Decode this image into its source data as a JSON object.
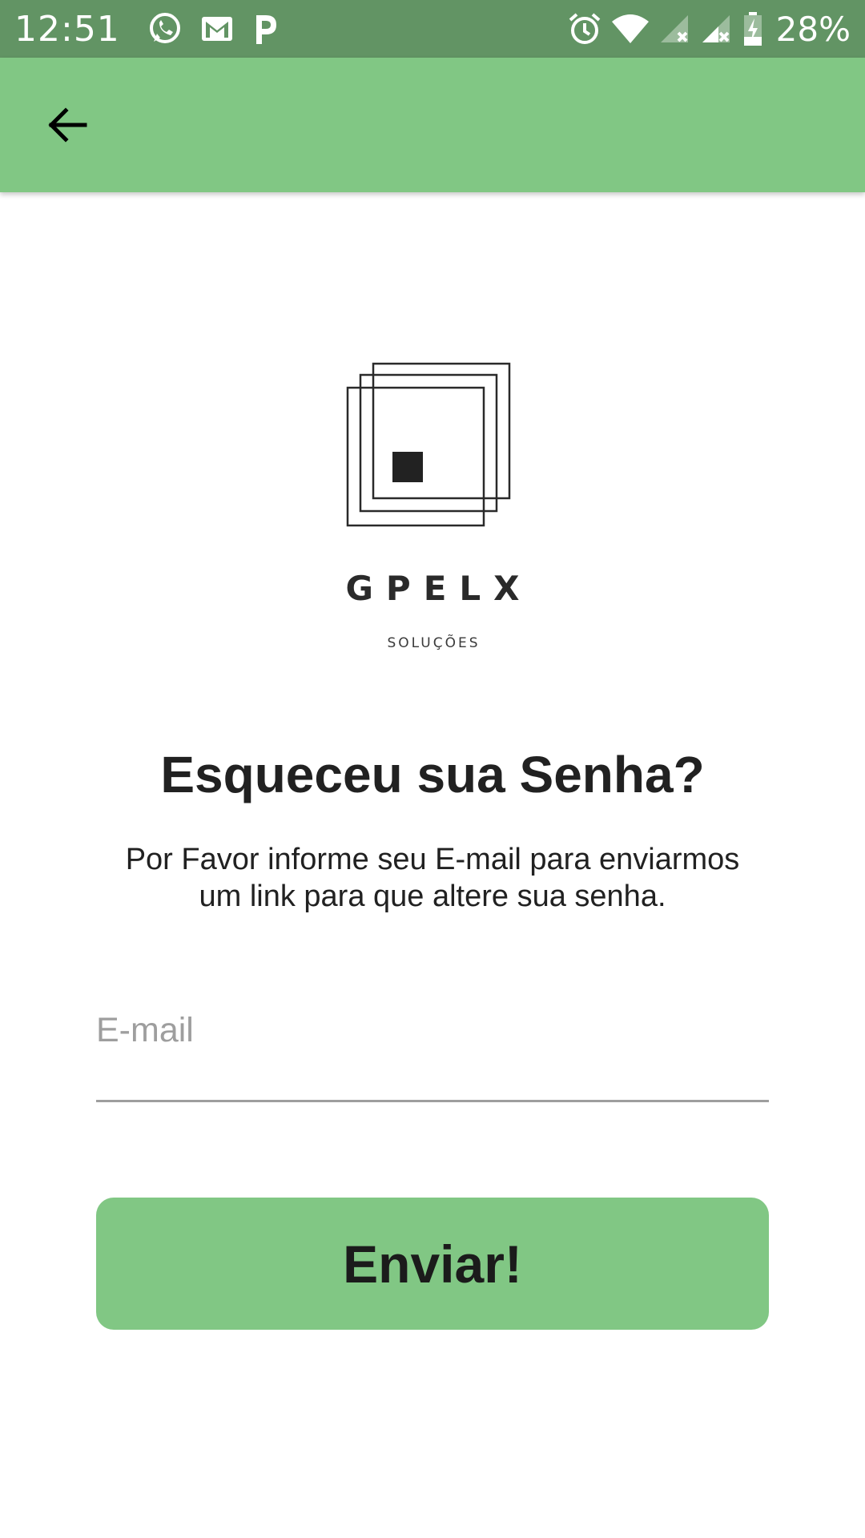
{
  "status_bar": {
    "time": "12:51",
    "notification_icons": [
      "whatsapp-icon",
      "gmail-icon",
      "p-app-icon"
    ],
    "system_icons": [
      "alarm-icon",
      "wifi-icon",
      "signal-no-data-icon",
      "signal-no-data-icon",
      "battery-charging-icon"
    ],
    "battery_percent": "28%",
    "background_color": "#629464"
  },
  "app_bar": {
    "back_icon": "arrow-back-icon",
    "background_color": "#81c784"
  },
  "logo": {
    "wordmark": "GPELX",
    "tagline": "SOLUÇÕES"
  },
  "main": {
    "title": "Esqueceu sua Senha?",
    "subtitle_line1": "Por Favor informe seu E-mail para enviarmos",
    "subtitle_line2": "um link para que altere sua senha.",
    "email_field": {
      "placeholder": "E-mail",
      "value": ""
    },
    "send_button_label": "Enviar!",
    "accent_color": "#81c784"
  }
}
